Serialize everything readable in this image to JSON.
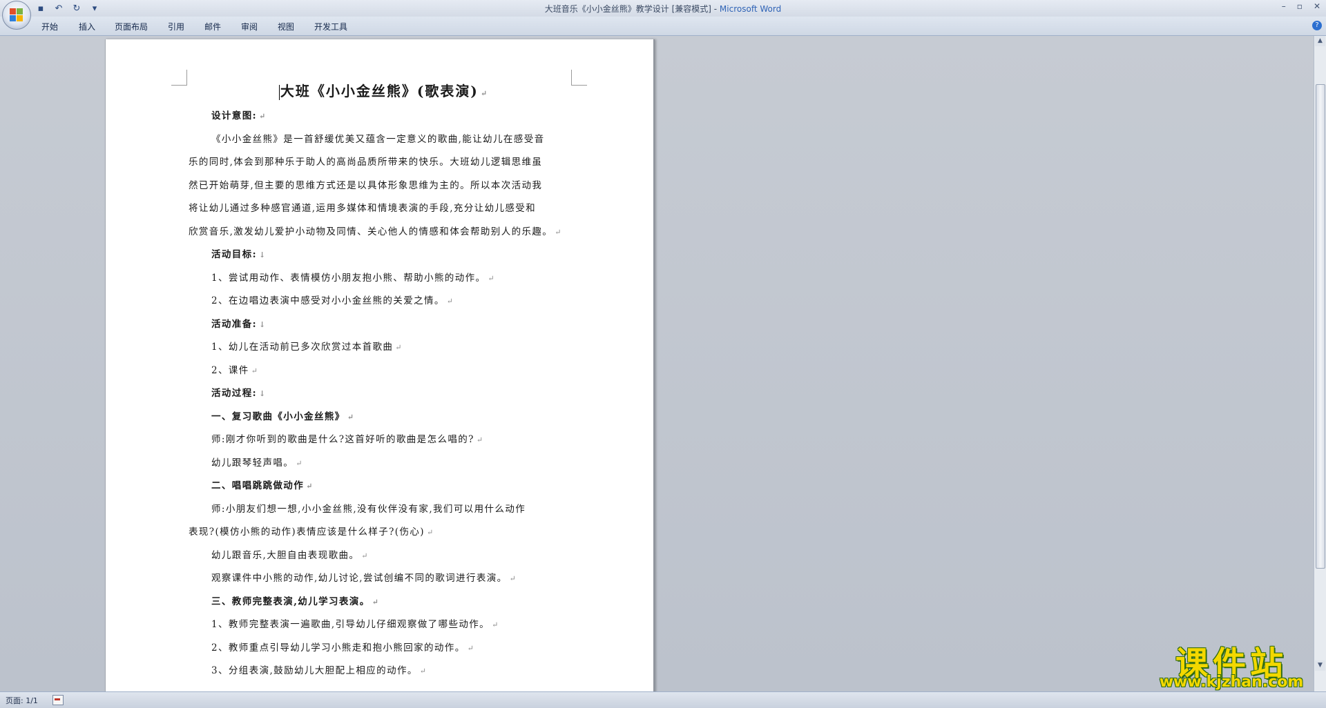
{
  "window": {
    "title_prefix": "大班音乐《小小金丝熊》教学设计 [兼容模式] - ",
    "title_app": "Microsoft Word",
    "minimize": "–",
    "maximize": "▫",
    "close": "✕"
  },
  "qat": {
    "save_icon": "▪",
    "undo_icon": "↶",
    "redo_icon": "↻",
    "customize_icon": "▾"
  },
  "ribbon": {
    "tabs": [
      "开始",
      "插入",
      "页面布局",
      "引用",
      "邮件",
      "审阅",
      "视图",
      "开发工具"
    ],
    "help": "?"
  },
  "document": {
    "title": "大班《小小金丝熊》(歌表演)",
    "paragraph_mark": "↵",
    "lines": [
      {
        "text": "设计意图:",
        "bold": true,
        "indent": true
      },
      {
        "text": "《小小金丝熊》是一首舒缓优美又蕴含一定意义的歌曲,能让幼儿在感受音",
        "bold": false,
        "indent": true,
        "noMark": true
      },
      {
        "text": "乐的同时,体会到那种乐于助人的高尚品质所带来的快乐。大班幼儿逻辑思维虽",
        "bold": false,
        "indent": false,
        "noMark": true
      },
      {
        "text": "然已开始萌芽,但主要的思维方式还是以具体形象思维为主的。所以本次活动我",
        "bold": false,
        "indent": false,
        "noMark": true
      },
      {
        "text": "将让幼儿通过多种感官通道,运用多媒体和情境表演的手段,充分让幼儿感受和",
        "bold": false,
        "indent": false,
        "noMark": true
      },
      {
        "text": "欣赏音乐,激发幼儿爱护小动物及同情、关心他人的情感和体会帮助别人的乐趣。",
        "bold": false,
        "indent": false
      },
      {
        "text": "活动目标:",
        "bold": true,
        "indent": true,
        "mark": "↓"
      },
      {
        "text": "1、尝试用动作、表情模仿小朋友抱小熊、帮助小熊的动作。",
        "bold": false,
        "indent": true
      },
      {
        "text": "2、在边唱边表演中感受对小小金丝熊的关爱之情。",
        "bold": false,
        "indent": true
      },
      {
        "text": "活动准备:",
        "bold": true,
        "indent": true,
        "mark": "↓"
      },
      {
        "text": "1、幼儿在活动前已多次欣赏过本首歌曲",
        "bold": false,
        "indent": true
      },
      {
        "text": "2、课件",
        "bold": false,
        "indent": true
      },
      {
        "text": "活动过程:",
        "bold": true,
        "indent": true,
        "mark": "↓"
      },
      {
        "text": "一、复习歌曲《小小金丝熊》",
        "bold": true,
        "indent": true
      },
      {
        "text": "师:刚才你听到的歌曲是什么?这首好听的歌曲是怎么唱的?",
        "bold": false,
        "indent": true
      },
      {
        "text": "幼儿跟琴轻声唱。",
        "bold": false,
        "indent": true
      },
      {
        "text": "二、唱唱跳跳做动作",
        "bold": true,
        "indent": true
      },
      {
        "text": "师:小朋友们想一想,小小金丝熊,没有伙伴没有家,我们可以用什么动作",
        "bold": false,
        "indent": true,
        "noMark": true
      },
      {
        "text": "表现?(模仿小熊的动作)表情应该是什么样子?(伤心)",
        "bold": false,
        "indent": false
      },
      {
        "text": "幼儿跟音乐,大胆自由表现歌曲。",
        "bold": false,
        "indent": true
      },
      {
        "text": "观察课件中小熊的动作,幼儿讨论,尝试创编不同的歌词进行表演。",
        "bold": false,
        "indent": true
      },
      {
        "text": "三、教师完整表演,幼儿学习表演。",
        "bold": true,
        "indent": true
      },
      {
        "text": "1、教师完整表演一遍歌曲,引导幼儿仔细观察做了哪些动作。",
        "bold": false,
        "indent": true
      },
      {
        "text": "2、教师重点引导幼儿学习小熊走和抱小熊回家的动作。",
        "bold": false,
        "indent": true
      },
      {
        "text": "3、分组表演,鼓励幼儿大胆配上相应的动作。",
        "bold": false,
        "indent": true
      }
    ]
  },
  "status": {
    "page_count": "页面: 1/1"
  },
  "watermark": {
    "line1": "课件站",
    "line2": "www.kjzhan.com"
  },
  "colors": {
    "title_app": "#2f63b6",
    "watermark": "#f3d800",
    "watermark_outline": "#2f6b12"
  }
}
